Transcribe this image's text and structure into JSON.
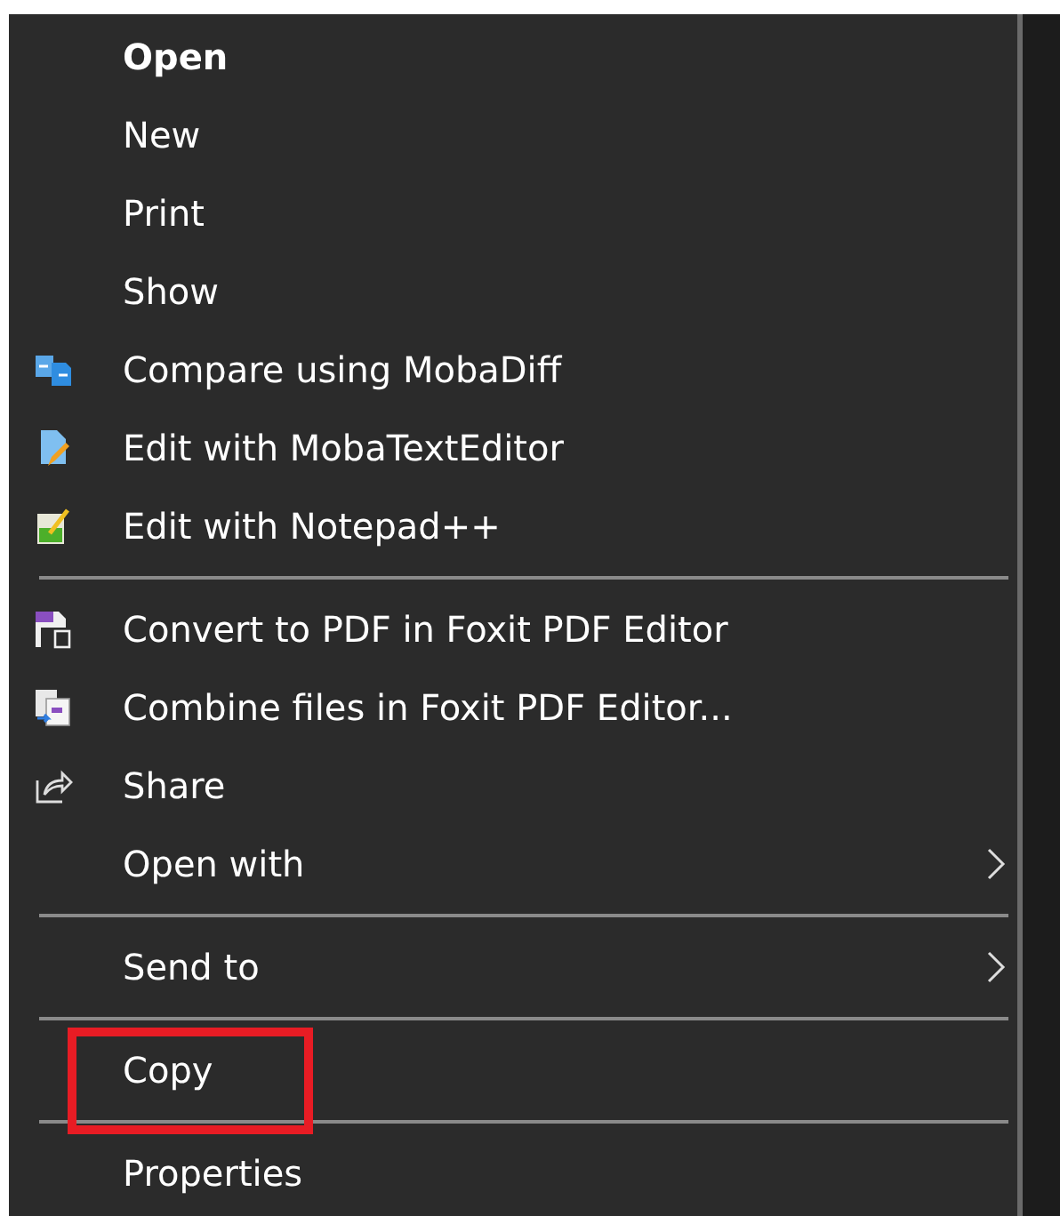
{
  "context_menu": {
    "items": [
      {
        "kind": "item",
        "label": "Open",
        "default": true
      },
      {
        "kind": "item",
        "label": "New"
      },
      {
        "kind": "item",
        "label": "Print"
      },
      {
        "kind": "item",
        "label": "Show"
      },
      {
        "kind": "item",
        "label": "Compare using MobaDiff"
      },
      {
        "kind": "item",
        "label": "Edit with MobaTextEditor"
      },
      {
        "kind": "item",
        "label": "Edit with Notepad++"
      },
      {
        "kind": "separator"
      },
      {
        "kind": "item",
        "label": "Convert to PDF in Foxit PDF Editor"
      },
      {
        "kind": "item",
        "label": "Combine files in Foxit PDF Editor..."
      },
      {
        "kind": "item",
        "label": "Share"
      },
      {
        "kind": "item",
        "label": "Open with",
        "submenu": true
      },
      {
        "kind": "separator"
      },
      {
        "kind": "item",
        "label": "Send to",
        "submenu": true
      },
      {
        "kind": "separator"
      },
      {
        "kind": "item",
        "label": "Copy",
        "annotated": true
      },
      {
        "kind": "separator"
      },
      {
        "kind": "item",
        "label": "Properties"
      }
    ]
  }
}
